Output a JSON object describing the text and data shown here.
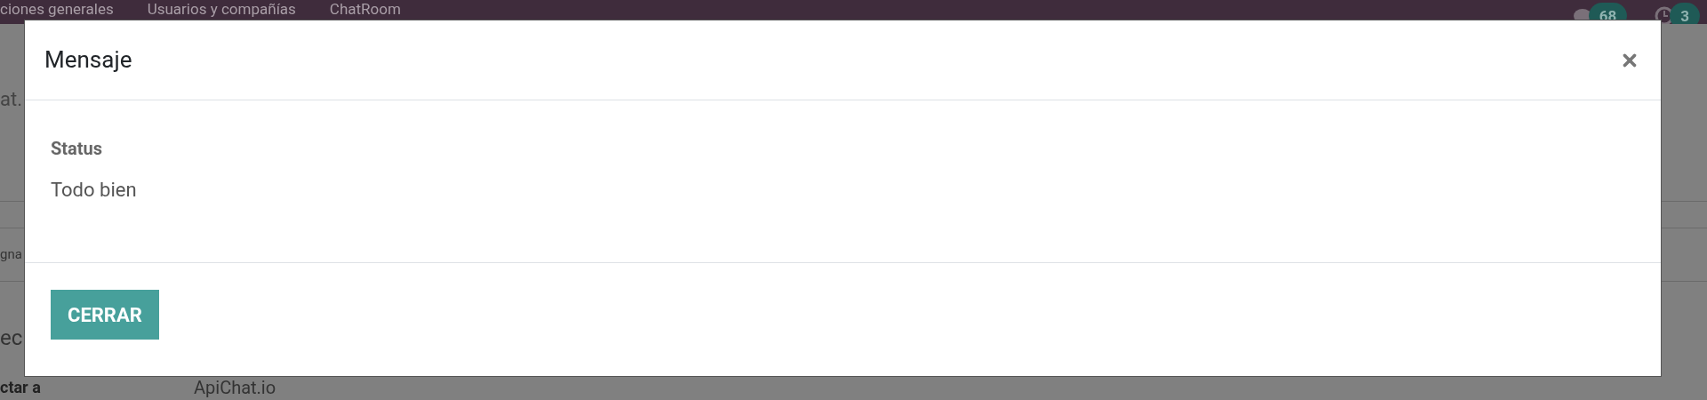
{
  "navbar": {
    "menu_items": [
      "ciones generales",
      "Usuarios y compañías",
      "ChatRoom"
    ],
    "chat_badge": "68",
    "activity_badge": "3"
  },
  "background": {
    "title": "at.",
    "tab": "gna",
    "section": "ec",
    "field_label": "ctar a",
    "field_value": "ApiChat.io"
  },
  "dialog": {
    "title": "Mensaje",
    "field": {
      "label": "Status",
      "value": "Todo bien"
    },
    "buttons": [
      "CERRAR"
    ]
  }
}
